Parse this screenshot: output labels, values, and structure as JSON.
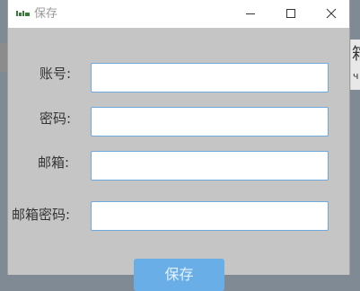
{
  "window": {
    "title": "保存",
    "app_icon_text": "ᵢᵢᵢ",
    "controls": {
      "minimize": "minimize-icon",
      "maximize": "maximize-icon",
      "close": "close-icon"
    }
  },
  "form": {
    "account_label": "账号:",
    "password_label": "密码:",
    "email_label": "邮箱:",
    "email_password_label": "邮箱密码:",
    "account_value": "",
    "password_value": "",
    "email_value": "",
    "email_password_value": ""
  },
  "actions": {
    "save_label": "保存"
  },
  "background": {
    "right_glyph": "箱",
    "right_glyph2": "ч"
  },
  "colors": {
    "dialog_bg": "#c5c5c5",
    "field_border": "#6fa8dc",
    "button_bg": "#6aaee8",
    "titlebar_bg": "#ffffff"
  }
}
